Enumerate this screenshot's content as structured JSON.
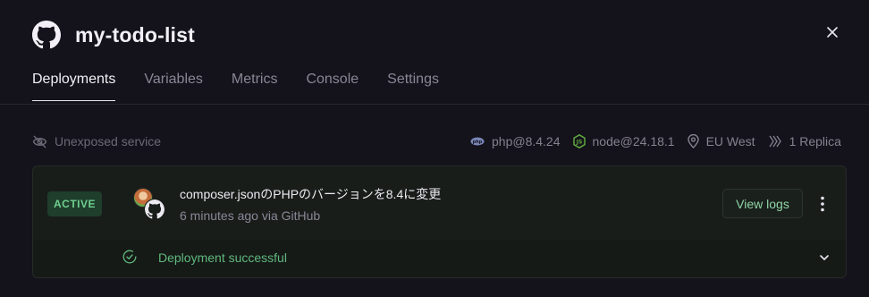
{
  "header": {
    "title": "my-todo-list",
    "logo_icon": "github-icon",
    "close_icon": "close-icon"
  },
  "tabs": [
    {
      "label": "Deployments",
      "active": true
    },
    {
      "label": "Variables",
      "active": false
    },
    {
      "label": "Metrics",
      "active": false
    },
    {
      "label": "Console",
      "active": false
    },
    {
      "label": "Settings",
      "active": false
    }
  ],
  "service_meta": {
    "exposure": "Unexposed service",
    "php": "php@8.4.24",
    "node": "node@24.18.1",
    "region": "EU West",
    "replicas": "1 Replica"
  },
  "deployment": {
    "status": "ACTIVE",
    "commit_message": "composer.jsonのPHPのバージョンを8.4に変更",
    "time_source": "6 minutes ago via GitHub",
    "view_logs_label": "View logs",
    "result": "Deployment successful"
  },
  "colors": {
    "background": "#14121a",
    "active_badge": "#1f3e2c",
    "success": "#5fb87d"
  }
}
